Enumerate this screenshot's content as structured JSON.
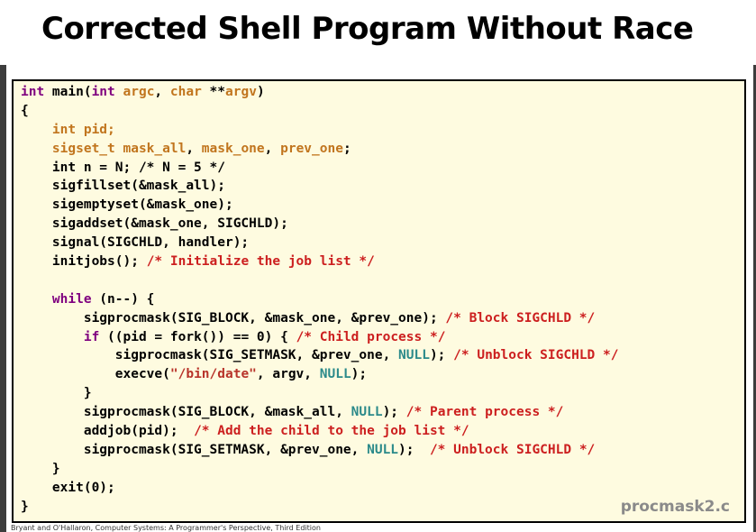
{
  "slide": {
    "title": "Corrected Shell Program Without Race",
    "filename": "procmask2.c",
    "footer": "Bryant and O'Hallaron, Computer Systems: A Programmer's Perspective, Third Edition"
  },
  "code": {
    "lines": [
      [
        {
          "t": "int ",
          "c": "kw"
        },
        {
          "t": "main(",
          "c": ""
        },
        {
          "t": "int ",
          "c": "kw"
        },
        {
          "t": "argc",
          "c": "ty"
        },
        {
          "t": ", ",
          "c": ""
        },
        {
          "t": "char ",
          "c": "ty"
        },
        {
          "t": "**",
          "c": ""
        },
        {
          "t": "argv",
          "c": "ty"
        },
        {
          "t": ")",
          "c": ""
        }
      ],
      [
        {
          "t": "{",
          "c": ""
        }
      ],
      [
        {
          "t": "    ",
          "c": ""
        },
        {
          "t": "int ",
          "c": "ty"
        },
        {
          "t": "pid;",
          "c": "ty"
        }
      ],
      [
        {
          "t": "    ",
          "c": ""
        },
        {
          "t": "sigset_t mask_all",
          "c": "ty"
        },
        {
          "t": ", ",
          "c": ""
        },
        {
          "t": "mask_one",
          "c": "ty"
        },
        {
          "t": ", ",
          "c": ""
        },
        {
          "t": "prev_one",
          "c": "ty"
        },
        {
          "t": ";",
          "c": ""
        }
      ],
      [
        {
          "t": "    int n = N; /* N = 5 */",
          "c": ""
        }
      ],
      [
        {
          "t": "    sigfillset(&mask_all);",
          "c": ""
        }
      ],
      [
        {
          "t": "    sigemptyset(&mask_one);",
          "c": ""
        }
      ],
      [
        {
          "t": "    sigaddset(&mask_one, SIGCHLD);",
          "c": ""
        }
      ],
      [
        {
          "t": "    signal(SIGCHLD, handler);",
          "c": ""
        }
      ],
      [
        {
          "t": "    initjobs(); ",
          "c": ""
        },
        {
          "t": "/* Initialize the job list */",
          "c": "cm"
        }
      ],
      [
        {
          "t": "",
          "c": ""
        }
      ],
      [
        {
          "t": "    ",
          "c": ""
        },
        {
          "t": "while",
          "c": "kw"
        },
        {
          "t": " (n--) {",
          "c": ""
        }
      ],
      [
        {
          "t": "        sigprocmask(SIG_BLOCK, &mask_one, &prev_one); ",
          "c": ""
        },
        {
          "t": "/* Block SIGCHLD */",
          "c": "cm"
        }
      ],
      [
        {
          "t": "        ",
          "c": ""
        },
        {
          "t": "if",
          "c": "kw"
        },
        {
          "t": " ((pid = fork()) == 0) { ",
          "c": ""
        },
        {
          "t": "/* Child process */",
          "c": "cm"
        }
      ],
      [
        {
          "t": "            sigprocmask(SIG_SETMASK, &prev_one, ",
          "c": ""
        },
        {
          "t": "NULL",
          "c": "nl"
        },
        {
          "t": "); ",
          "c": ""
        },
        {
          "t": "/* Unblock SIGCHLD */",
          "c": "cm"
        }
      ],
      [
        {
          "t": "            execve(",
          "c": ""
        },
        {
          "t": "\"/bin/date\"",
          "c": "st"
        },
        {
          "t": ", argv, ",
          "c": ""
        },
        {
          "t": "NULL",
          "c": "nl"
        },
        {
          "t": ");",
          "c": ""
        }
      ],
      [
        {
          "t": "        }",
          "c": ""
        }
      ],
      [
        {
          "t": "        sigprocmask(SIG_BLOCK, &mask_all, ",
          "c": ""
        },
        {
          "t": "NULL",
          "c": "nl"
        },
        {
          "t": "); ",
          "c": ""
        },
        {
          "t": "/* Parent process */",
          "c": "cm"
        }
      ],
      [
        {
          "t": "        addjob(pid);  ",
          "c": ""
        },
        {
          "t": "/* Add the child to the job list */",
          "c": "cm"
        }
      ],
      [
        {
          "t": "        sigprocmask(SIG_SETMASK, &prev_one, ",
          "c": ""
        },
        {
          "t": "NULL",
          "c": "nl"
        },
        {
          "t": ");  ",
          "c": ""
        },
        {
          "t": "/* Unblock SIGCHLD */",
          "c": "cm"
        }
      ],
      [
        {
          "t": "    }",
          "c": ""
        }
      ],
      [
        {
          "t": "    exit(0);",
          "c": ""
        }
      ],
      [
        {
          "t": "}",
          "c": ""
        }
      ]
    ]
  },
  "colors": {
    "keyword": "#7f007f",
    "type_and_identifier": "#c1751e",
    "comment": "#cc1f1f",
    "string": "#b8342a",
    "null_constant": "#2b8a8a",
    "code_background": "#fefbe0",
    "filename": "#8a8a8a"
  }
}
